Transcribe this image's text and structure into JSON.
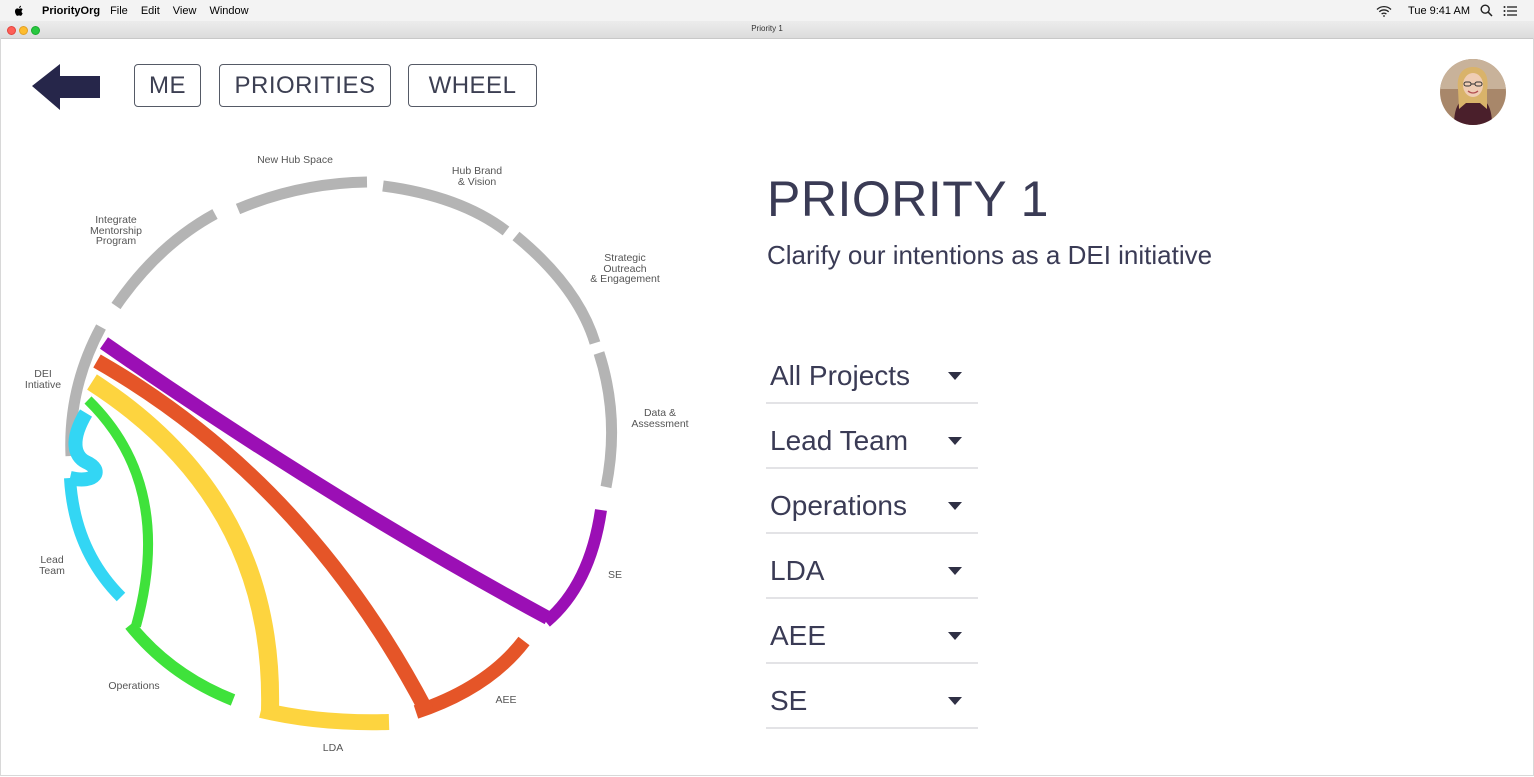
{
  "menubar": {
    "app_name": "PriorityOrg",
    "menus": [
      "File",
      "Edit",
      "View",
      "Window"
    ],
    "clock": "Tue 9:41 AM"
  },
  "window": {
    "title": "Priority 1"
  },
  "nav": {
    "me": "ME",
    "priorities": "PRIORITIES",
    "wheel": "WHEEL"
  },
  "priority": {
    "title": "PRIORITY 1",
    "subtitle": "Clarify our intentions as a DEI initiative"
  },
  "filters": [
    "All Projects",
    "Lead Team",
    "Operations",
    "LDA",
    "AEE",
    "SE"
  ],
  "wheel": {
    "segments": [
      {
        "label": "New Hub Space"
      },
      {
        "label": "Hub Brand\n& Vision"
      },
      {
        "label": "Strategic\nOutreach\n& Engagement"
      },
      {
        "label": "Data &\nAssessment"
      },
      {
        "label": "SE"
      },
      {
        "label": "AEE"
      },
      {
        "label": "LDA"
      },
      {
        "label": "Operations"
      },
      {
        "label": "Lead\nTeam"
      },
      {
        "label": "DEI\nIntiative"
      },
      {
        "label": "Integrate\nMentorship\nProgram"
      }
    ],
    "colors": {
      "inactive": "#b4b4b4",
      "lead_team": "#33d6f4",
      "operations": "#3fe23b",
      "lda": "#fdd43f",
      "aee": "#e55528",
      "se": "#9b0fb5"
    }
  }
}
